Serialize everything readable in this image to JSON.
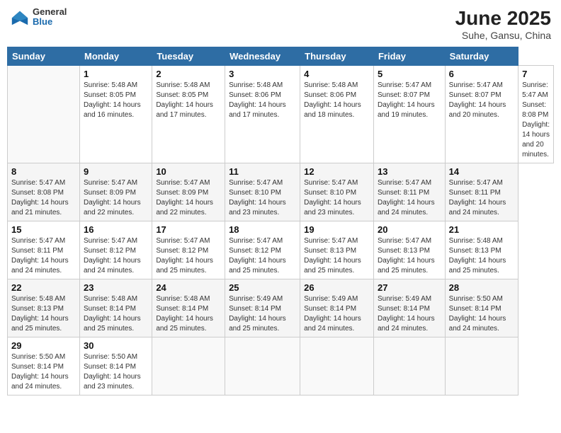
{
  "header": {
    "logo_general": "General",
    "logo_blue": "Blue",
    "month_title": "June 2025",
    "location": "Suhe, Gansu, China"
  },
  "calendar": {
    "days_of_week": [
      "Sunday",
      "Monday",
      "Tuesday",
      "Wednesday",
      "Thursday",
      "Friday",
      "Saturday"
    ],
    "weeks": [
      [
        null,
        {
          "day": "1",
          "sunrise": "Sunrise: 5:48 AM",
          "sunset": "Sunset: 8:05 PM",
          "daylight": "Daylight: 14 hours and 16 minutes."
        },
        {
          "day": "2",
          "sunrise": "Sunrise: 5:48 AM",
          "sunset": "Sunset: 8:05 PM",
          "daylight": "Daylight: 14 hours and 17 minutes."
        },
        {
          "day": "3",
          "sunrise": "Sunrise: 5:48 AM",
          "sunset": "Sunset: 8:06 PM",
          "daylight": "Daylight: 14 hours and 17 minutes."
        },
        {
          "day": "4",
          "sunrise": "Sunrise: 5:48 AM",
          "sunset": "Sunset: 8:06 PM",
          "daylight": "Daylight: 14 hours and 18 minutes."
        },
        {
          "day": "5",
          "sunrise": "Sunrise: 5:47 AM",
          "sunset": "Sunset: 8:07 PM",
          "daylight": "Daylight: 14 hours and 19 minutes."
        },
        {
          "day": "6",
          "sunrise": "Sunrise: 5:47 AM",
          "sunset": "Sunset: 8:07 PM",
          "daylight": "Daylight: 14 hours and 20 minutes."
        },
        {
          "day": "7",
          "sunrise": "Sunrise: 5:47 AM",
          "sunset": "Sunset: 8:08 PM",
          "daylight": "Daylight: 14 hours and 20 minutes."
        }
      ],
      [
        {
          "day": "8",
          "sunrise": "Sunrise: 5:47 AM",
          "sunset": "Sunset: 8:08 PM",
          "daylight": "Daylight: 14 hours and 21 minutes."
        },
        {
          "day": "9",
          "sunrise": "Sunrise: 5:47 AM",
          "sunset": "Sunset: 8:09 PM",
          "daylight": "Daylight: 14 hours and 22 minutes."
        },
        {
          "day": "10",
          "sunrise": "Sunrise: 5:47 AM",
          "sunset": "Sunset: 8:09 PM",
          "daylight": "Daylight: 14 hours and 22 minutes."
        },
        {
          "day": "11",
          "sunrise": "Sunrise: 5:47 AM",
          "sunset": "Sunset: 8:10 PM",
          "daylight": "Daylight: 14 hours and 23 minutes."
        },
        {
          "day": "12",
          "sunrise": "Sunrise: 5:47 AM",
          "sunset": "Sunset: 8:10 PM",
          "daylight": "Daylight: 14 hours and 23 minutes."
        },
        {
          "day": "13",
          "sunrise": "Sunrise: 5:47 AM",
          "sunset": "Sunset: 8:11 PM",
          "daylight": "Daylight: 14 hours and 24 minutes."
        },
        {
          "day": "14",
          "sunrise": "Sunrise: 5:47 AM",
          "sunset": "Sunset: 8:11 PM",
          "daylight": "Daylight: 14 hours and 24 minutes."
        }
      ],
      [
        {
          "day": "15",
          "sunrise": "Sunrise: 5:47 AM",
          "sunset": "Sunset: 8:11 PM",
          "daylight": "Daylight: 14 hours and 24 minutes."
        },
        {
          "day": "16",
          "sunrise": "Sunrise: 5:47 AM",
          "sunset": "Sunset: 8:12 PM",
          "daylight": "Daylight: 14 hours and 24 minutes."
        },
        {
          "day": "17",
          "sunrise": "Sunrise: 5:47 AM",
          "sunset": "Sunset: 8:12 PM",
          "daylight": "Daylight: 14 hours and 25 minutes."
        },
        {
          "day": "18",
          "sunrise": "Sunrise: 5:47 AM",
          "sunset": "Sunset: 8:12 PM",
          "daylight": "Daylight: 14 hours and 25 minutes."
        },
        {
          "day": "19",
          "sunrise": "Sunrise: 5:47 AM",
          "sunset": "Sunset: 8:13 PM",
          "daylight": "Daylight: 14 hours and 25 minutes."
        },
        {
          "day": "20",
          "sunrise": "Sunrise: 5:47 AM",
          "sunset": "Sunset: 8:13 PM",
          "daylight": "Daylight: 14 hours and 25 minutes."
        },
        {
          "day": "21",
          "sunrise": "Sunrise: 5:48 AM",
          "sunset": "Sunset: 8:13 PM",
          "daylight": "Daylight: 14 hours and 25 minutes."
        }
      ],
      [
        {
          "day": "22",
          "sunrise": "Sunrise: 5:48 AM",
          "sunset": "Sunset: 8:13 PM",
          "daylight": "Daylight: 14 hours and 25 minutes."
        },
        {
          "day": "23",
          "sunrise": "Sunrise: 5:48 AM",
          "sunset": "Sunset: 8:14 PM",
          "daylight": "Daylight: 14 hours and 25 minutes."
        },
        {
          "day": "24",
          "sunrise": "Sunrise: 5:48 AM",
          "sunset": "Sunset: 8:14 PM",
          "daylight": "Daylight: 14 hours and 25 minutes."
        },
        {
          "day": "25",
          "sunrise": "Sunrise: 5:49 AM",
          "sunset": "Sunset: 8:14 PM",
          "daylight": "Daylight: 14 hours and 25 minutes."
        },
        {
          "day": "26",
          "sunrise": "Sunrise: 5:49 AM",
          "sunset": "Sunset: 8:14 PM",
          "daylight": "Daylight: 14 hours and 24 minutes."
        },
        {
          "day": "27",
          "sunrise": "Sunrise: 5:49 AM",
          "sunset": "Sunset: 8:14 PM",
          "daylight": "Daylight: 14 hours and 24 minutes."
        },
        {
          "day": "28",
          "sunrise": "Sunrise: 5:50 AM",
          "sunset": "Sunset: 8:14 PM",
          "daylight": "Daylight: 14 hours and 24 minutes."
        }
      ],
      [
        {
          "day": "29",
          "sunrise": "Sunrise: 5:50 AM",
          "sunset": "Sunset: 8:14 PM",
          "daylight": "Daylight: 14 hours and 24 minutes."
        },
        {
          "day": "30",
          "sunrise": "Sunrise: 5:50 AM",
          "sunset": "Sunset: 8:14 PM",
          "daylight": "Daylight: 14 hours and 23 minutes."
        },
        null,
        null,
        null,
        null,
        null
      ]
    ]
  }
}
